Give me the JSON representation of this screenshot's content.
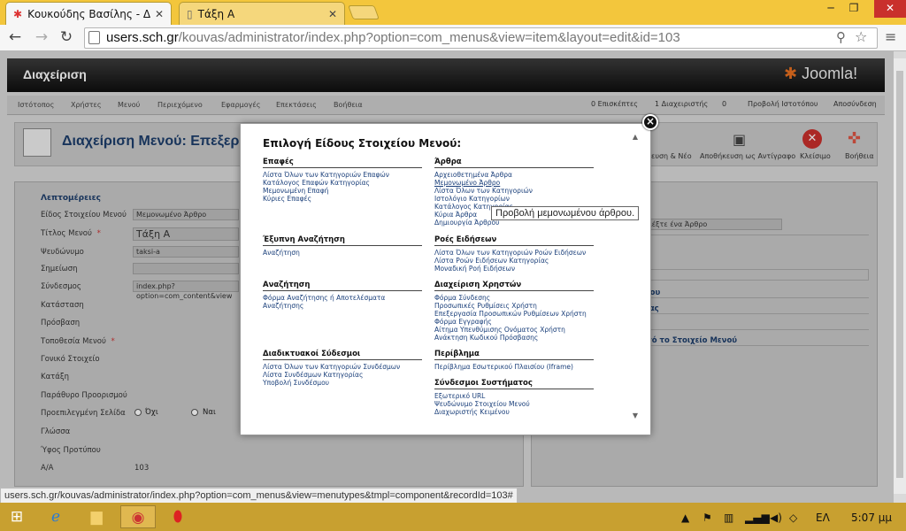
{
  "browser": {
    "tabs": [
      {
        "label": "Κουκούδης Βασίλης - Δια",
        "close": "✕"
      },
      {
        "label": "Τάξη Α",
        "close": "✕"
      }
    ],
    "url_host": "users.sch.gr",
    "url_path": "/kouvas/administrator/index.php?option=com_menus&view=item&layout=edit&id=103",
    "status_url": "users.sch.gr/kouvas/administrator/index.php?option=com_menus&view=menutypes&tmpl=component&recordId=103#"
  },
  "joomla": {
    "title": "Διαχείριση",
    "logo": "Joomla!",
    "menu": [
      "Ιστότοπος",
      "Χρήστες",
      "Μενού",
      "Περιεχόμενο",
      "Εφαρμογές",
      "Επεκτάσεις",
      "Βοήθεια"
    ],
    "status": {
      "visitors": "0 Επισκέπτες",
      "admins": "1 Διαχειριστής",
      "messages": "0",
      "view_site": "Προβολή Ιστοτόπου",
      "logout": "Αποσύνδεση"
    },
    "page_title": "Διαχείριση Μενού: Επεξερ",
    "toolbar": [
      "ευση & Νέο",
      "Αποθήκευση ως Αντίγραφο",
      "Κλείσιμο",
      "Βοήθεια"
    ],
    "details_legend": "Λεπτομέρειες",
    "fields": [
      {
        "label": "Είδος Στοιχείου Μενού",
        "req": " *",
        "value": "Μεμονωμένο Άρθρο"
      },
      {
        "label": "Τίτλος Μενού",
        "req": " *",
        "value": "Τάξη Α"
      },
      {
        "label": "Ψευδώνυμο",
        "req": "",
        "value": "taksi-a"
      },
      {
        "label": "Σημείωση",
        "req": "",
        "value": ""
      },
      {
        "label": "Σύνδεσμος",
        "req": "",
        "value": "index.php?option=com_content&view"
      },
      {
        "label": "Κατάσταση",
        "req": "",
        "value": ""
      },
      {
        "label": "Πρόσβαση",
        "req": "",
        "value": ""
      },
      {
        "label": "Τοποθεσία Μενού",
        "req": " *",
        "value": ""
      },
      {
        "label": "Γονικό Στοιχείο",
        "req": "",
        "value": ""
      },
      {
        "label": "Κατάξη",
        "req": "",
        "value": ""
      },
      {
        "label": "Παράθυρο Προορισμού",
        "req": "",
        "value": ""
      },
      {
        "label": "Προεπιλεγμένη Σελίδα",
        "req": "",
        "value": ""
      },
      {
        "label": "Γλώσσα",
        "req": "",
        "value": ""
      },
      {
        "label": "Ύφος Προτύπου",
        "req": "",
        "value": ""
      },
      {
        "label": "Α/Α",
        "req": "",
        "value": "103"
      }
    ],
    "radio_no": "Όχι",
    "radio_yes": "Ναι",
    "right_select": "λέξτε ένα Άρθρο",
    "right_lines": [
      "σου",
      "δας",
      "ν",
      "ιτό το Στοιχείο Μενού"
    ]
  },
  "modal": {
    "heading": "Επιλογή Είδους Στοιχείου Μενού:",
    "sections_left": [
      {
        "title": "Επαφές",
        "links": [
          "Λίστα Όλων των Κατηγοριών Επαφών",
          "Κατάλογος Επαφών Κατηγορίας",
          "Μεμονωμένη Επαφή",
          "Κύριες Επαφές"
        ]
      },
      {
        "title": "Έξυπνη Αναζήτηση",
        "links": [
          "Αναζήτηση"
        ]
      },
      {
        "title": "Αναζήτηση",
        "links": [
          "Φόρμα Αναζήτησης ή Αποτελέσματα",
          "Αναζήτησης"
        ]
      },
      {
        "title": "Διαδικτυακοί Σύδεσμοι",
        "links": [
          "Λίστα Όλων των Κατηγοριών Συνδέσμων",
          "Λίστα Συνδέσμων Κατηγορίας",
          "Υποβολή Συνδέσμου"
        ]
      }
    ],
    "sections_right": [
      {
        "title": "Άρθρα",
        "links": [
          "Αρχειοθετημένα Άρθρα",
          "Μεμονωμένο Άρθρο",
          "Λίστα Όλων των Κατηγοριών",
          "Ιστολόγιο Κατηγορίων",
          "Κατάλογος Κατηγορίας",
          "Κύρια Άρθρα",
          "Δημιουργία Άρθρου"
        ]
      },
      {
        "title": "Ροές Ειδήσεων",
        "links": [
          "Λίστα Όλων των Κατηγοριών Ροών Ειδήσεων",
          "Λίστα Ροών Ειδήσεων Κατηγορίας",
          "Μοναδική Ροή Ειδήσεων"
        ]
      },
      {
        "title": "Διαχείριση Χρηστών",
        "links": [
          "Φόρμα Σύνδεσης",
          "Προσωπικές Ρυθμίσεις Χρήστη",
          "Επεξεργασία Προσωπικών Ρυθμίσεων Χρήστη",
          "Φόρμα Εγγραφής",
          "Αίτημα Υπενθύμισης Ονόματος Χρήστη",
          "Ανάκτηση Κωδικού Πρόσβασης"
        ]
      },
      {
        "title": "Περίβλημα",
        "links": [
          "Περίβλημα Εσωτερικού Πλαισίου (Iframe)"
        ]
      },
      {
        "title": "Σύνδεσμοι Συστήματος",
        "links": [
          "Εξωτερικό URL",
          "Ψευδώνυμο Στοιχείου Μενού",
          "Διαχωριστής Κειμένου"
        ]
      }
    ],
    "tooltip": "Προβολή μεμονωμένου άρθρου."
  },
  "taskbar": {
    "lang": "ΕΛ",
    "time": "5:07 μμ"
  }
}
